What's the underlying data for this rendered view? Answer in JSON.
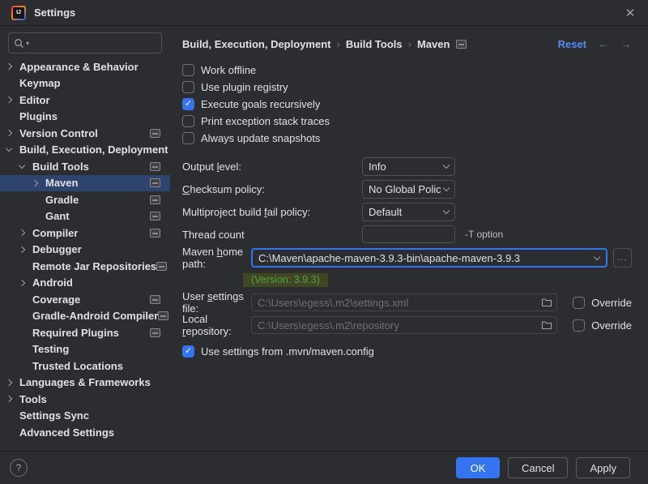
{
  "window": {
    "title": "Settings",
    "close_icon": "✕"
  },
  "icons": {
    "check": "✓",
    "search_caret": "▾",
    "back": "←",
    "forward": "→",
    "help": "?"
  },
  "colors": {
    "accent": "#3574f0",
    "selection": "#2e436e",
    "link": "#548af7",
    "version_text": "#4fa345",
    "version_highlight": "#414521"
  },
  "sidebar": {
    "items": [
      {
        "label": "Appearance & Behavior"
      },
      {
        "label": "Keymap"
      },
      {
        "label": "Editor"
      },
      {
        "label": "Plugins"
      },
      {
        "label": "Version Control"
      },
      {
        "label": "Build, Execution, Deployment"
      },
      {
        "label": "Build Tools"
      },
      {
        "label": "Maven"
      },
      {
        "label": "Gradle"
      },
      {
        "label": "Gant"
      },
      {
        "label": "Compiler"
      },
      {
        "label": "Debugger"
      },
      {
        "label": "Remote Jar Repositories"
      },
      {
        "label": "Android"
      },
      {
        "label": "Coverage"
      },
      {
        "label": "Gradle-Android Compiler"
      },
      {
        "label": "Required Plugins"
      },
      {
        "label": "Testing"
      },
      {
        "label": "Trusted Locations"
      },
      {
        "label": "Languages & Frameworks"
      },
      {
        "label": "Tools"
      },
      {
        "label": "Settings Sync"
      },
      {
        "label": "Advanced Settings"
      }
    ]
  },
  "breadcrumb": {
    "parts": [
      "Build, Execution, Deployment",
      "Build Tools",
      "Maven"
    ],
    "separator": "›"
  },
  "header": {
    "reset_label": "Reset"
  },
  "main": {
    "checkboxes": [
      {
        "label": "Work offline",
        "checked": false
      },
      {
        "label": "Use plugin registry",
        "checked": false
      },
      {
        "label": "Execute goals recursively",
        "checked": true
      },
      {
        "label": "Print exception stack traces",
        "checked": false
      },
      {
        "label": "Always update snapshots",
        "checked": false
      }
    ],
    "output_level": {
      "label_pre": "Output ",
      "label_u": "l",
      "label_post": "evel:",
      "value": "Info"
    },
    "checksum": {
      "label_pre": "",
      "label_u": "C",
      "label_post": "hecksum policy:",
      "value": "No Global Policy"
    },
    "multiproject": {
      "label_pre": "Multiproject build ",
      "label_u": "f",
      "label_post": "ail policy:",
      "value": "Default"
    },
    "thread_count": {
      "label": "Thread count",
      "value": "",
      "hint": "-T option"
    },
    "maven_home": {
      "label_pre": "Maven ",
      "label_u": "h",
      "label_post": "ome path:",
      "value": "C:\\Maven\\apache-maven-3.9.3-bin\\apache-maven-3.9.3",
      "version_note": "(Version: 3.9.3)",
      "browse_label": "..."
    },
    "user_settings": {
      "label_pre": "User ",
      "label_u": "s",
      "label_post": "ettings file:",
      "value": "C:\\Users\\egess\\.m2\\settings.xml",
      "override_label": "Override",
      "override_checked": false
    },
    "local_repository": {
      "label_pre": "Local ",
      "label_u": "r",
      "label_post": "epository:",
      "value": "C:\\Users\\egess\\.m2\\repository",
      "override_label": "Override",
      "override_checked": false
    },
    "use_settings_config": {
      "label": "Use settings from .mvn/maven.config",
      "checked": true
    }
  },
  "footer": {
    "ok": "OK",
    "cancel": "Cancel",
    "apply": "Apply"
  }
}
